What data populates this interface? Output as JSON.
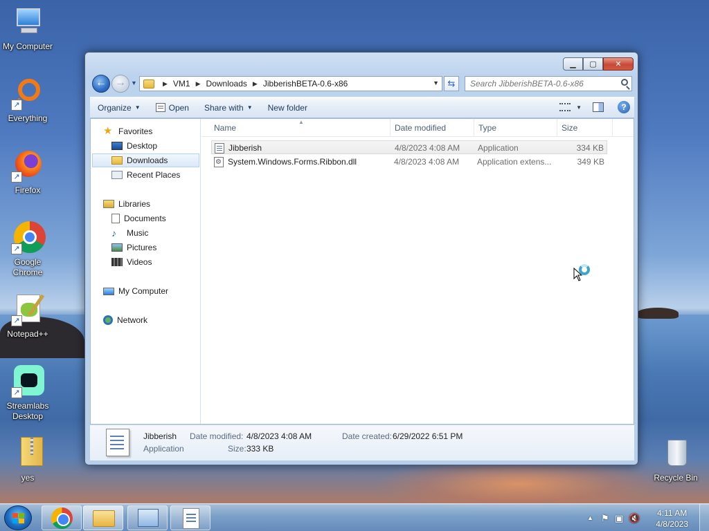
{
  "desktop": {
    "icons": [
      {
        "label": "My Computer",
        "icon": "computer-icon"
      },
      {
        "label": "Everything",
        "icon": "everything-icon"
      },
      {
        "label": "Firefox",
        "icon": "firefox-icon"
      },
      {
        "label": "Google Chrome",
        "icon": "chrome-icon"
      },
      {
        "label": "Notepad++",
        "icon": "notepadpp-icon"
      },
      {
        "label": "Streamlabs Desktop",
        "icon": "streamlabs-icon"
      },
      {
        "label": "yes",
        "icon": "zip-folder-icon"
      },
      {
        "label": "Recycle Bin",
        "icon": "recycle-bin-icon"
      }
    ]
  },
  "window": {
    "controls": {
      "minimize": "▁",
      "maximize": "▢",
      "close": "✕"
    },
    "address": {
      "crumbs": [
        "VM1",
        "Downloads",
        "JibberishBETA-0.6-x86"
      ]
    },
    "search": {
      "placeholder": "Search JibberishBETA-0.6-x86"
    },
    "toolbar": {
      "organize": "Organize",
      "open": "Open",
      "share_with": "Share with",
      "new_folder": "New folder"
    },
    "nav_pane": {
      "favorites": "Favorites",
      "desktop": "Desktop",
      "downloads": "Downloads",
      "recent_places": "Recent Places",
      "libraries": "Libraries",
      "documents": "Documents",
      "music": "Music",
      "pictures": "Pictures",
      "videos": "Videos",
      "my_computer": "My Computer",
      "network": "Network"
    },
    "columns": {
      "name": "Name",
      "date_modified": "Date modified",
      "type": "Type",
      "size": "Size"
    },
    "files": [
      {
        "name": "Jibberish",
        "date": "4/8/2023 4:08 AM",
        "type": "Application",
        "size": "334 KB"
      },
      {
        "name": "System.Windows.Forms.Ribbon.dll",
        "date": "4/8/2023 4:08 AM",
        "type": "Application extens...",
        "size": "349 KB"
      }
    ],
    "details": {
      "name": "Jibberish",
      "kind": "Application",
      "date_modified_label": "Date modified:",
      "date_modified": "4/8/2023 4:08 AM",
      "size_label": "Size:",
      "size": "333 KB",
      "date_created_label": "Date created:",
      "date_created": "6/29/2022 6:51 PM"
    }
  },
  "taskbar": {
    "time": "4:11 AM",
    "date": "4/8/2023"
  }
}
